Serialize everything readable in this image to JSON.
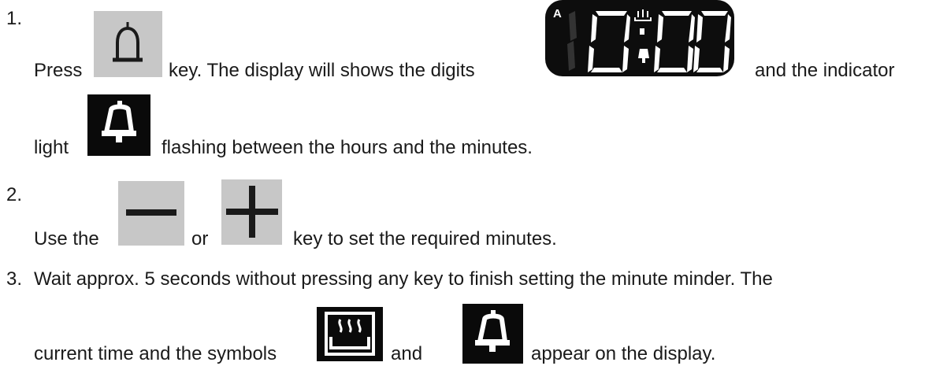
{
  "steps": [
    {
      "number": "1.",
      "line1": {
        "press": "Press",
        "key_text": "key. The display will shows the digits",
        "indicator_text": "and the indicator"
      },
      "line2": {
        "light": "light",
        "rest": "flashing between the hours and the minutes."
      },
      "display": {
        "mode_letter": "A",
        "digits": "0:00"
      }
    },
    {
      "number": "2.",
      "use_the": "Use the",
      "or": "or",
      "rest": "key to set the required minutes."
    },
    {
      "number": "3.",
      "line1": "Wait approx. 5 seconds without pressing any key to finish setting the minute minder. The",
      "line2_prefix": "current time and the symbols",
      "and": "and",
      "line2_suffix": "appear on the display."
    }
  ],
  "icons": {
    "bell_key": "bell-icon",
    "minus_key": "minus-icon",
    "plus_key": "plus-icon",
    "bell_indicator": "bell-icon",
    "cooking_indicator": "heating-icon"
  },
  "colors": {
    "text": "#1a1a1a",
    "key_gray": "#c7c7c7",
    "indicator_black": "#0a0a0a",
    "display_segments": "#ffffff"
  }
}
